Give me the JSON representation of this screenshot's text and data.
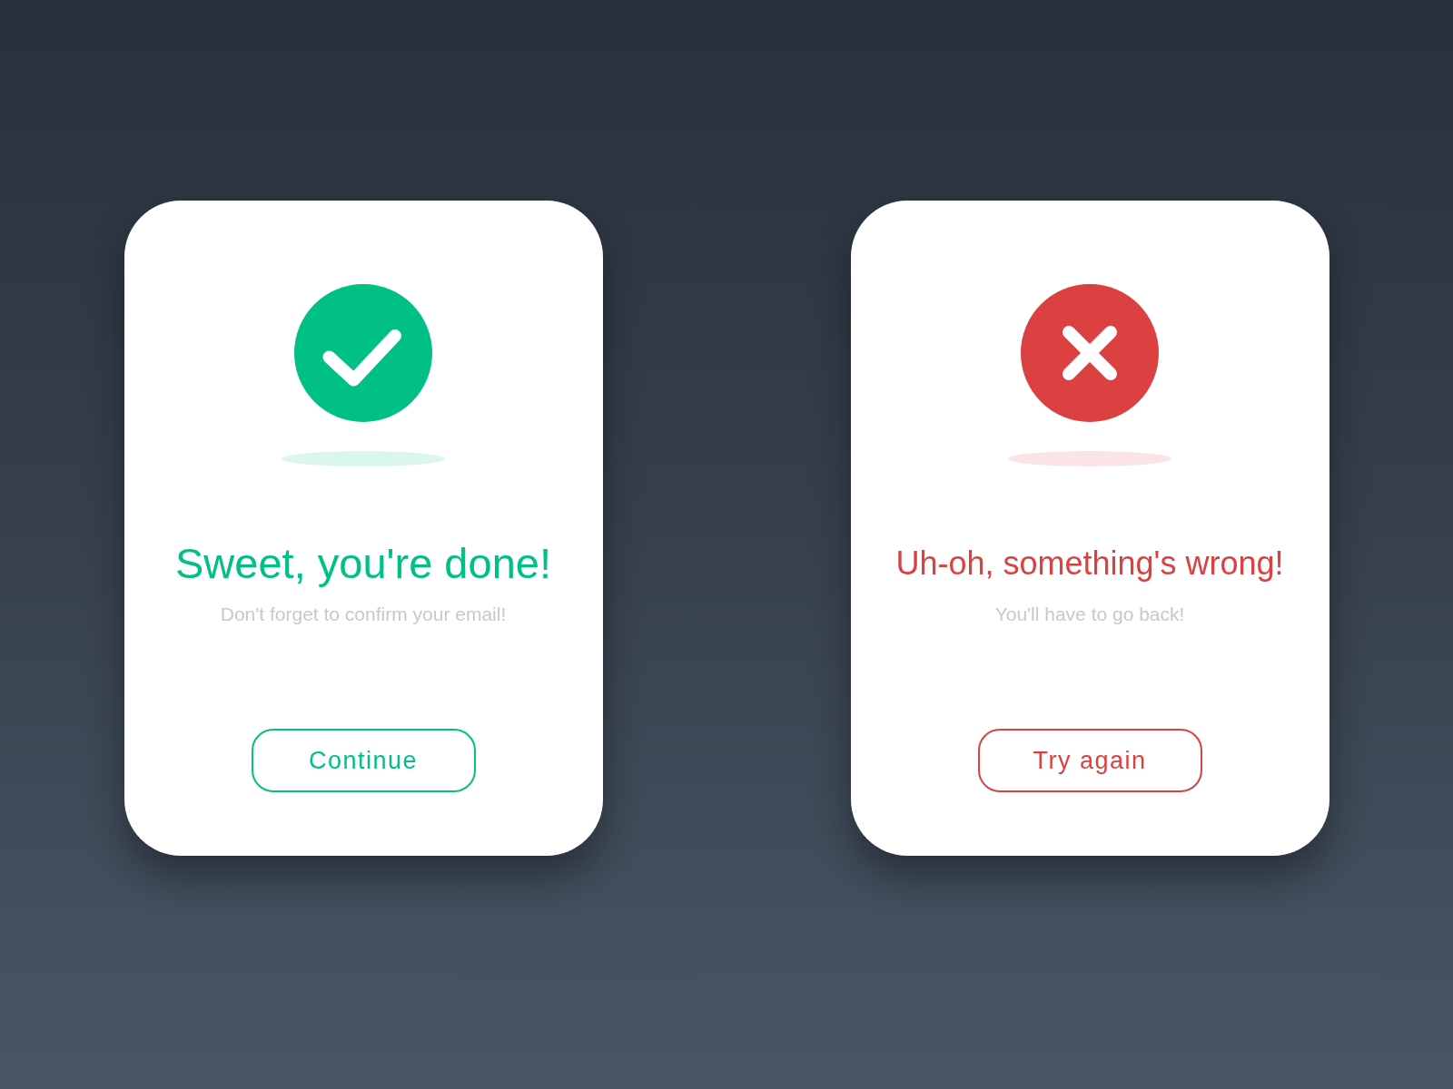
{
  "cards": [
    {
      "kind": "success",
      "color": "#00c085",
      "title": "Sweet, you're done!",
      "message": "Don't forget to confirm your email!",
      "button": "Continue"
    },
    {
      "kind": "error",
      "color": "#db4141",
      "title": "Uh-oh, something's wrong!",
      "message": "You'll have to go back!",
      "button": "Try again"
    }
  ]
}
